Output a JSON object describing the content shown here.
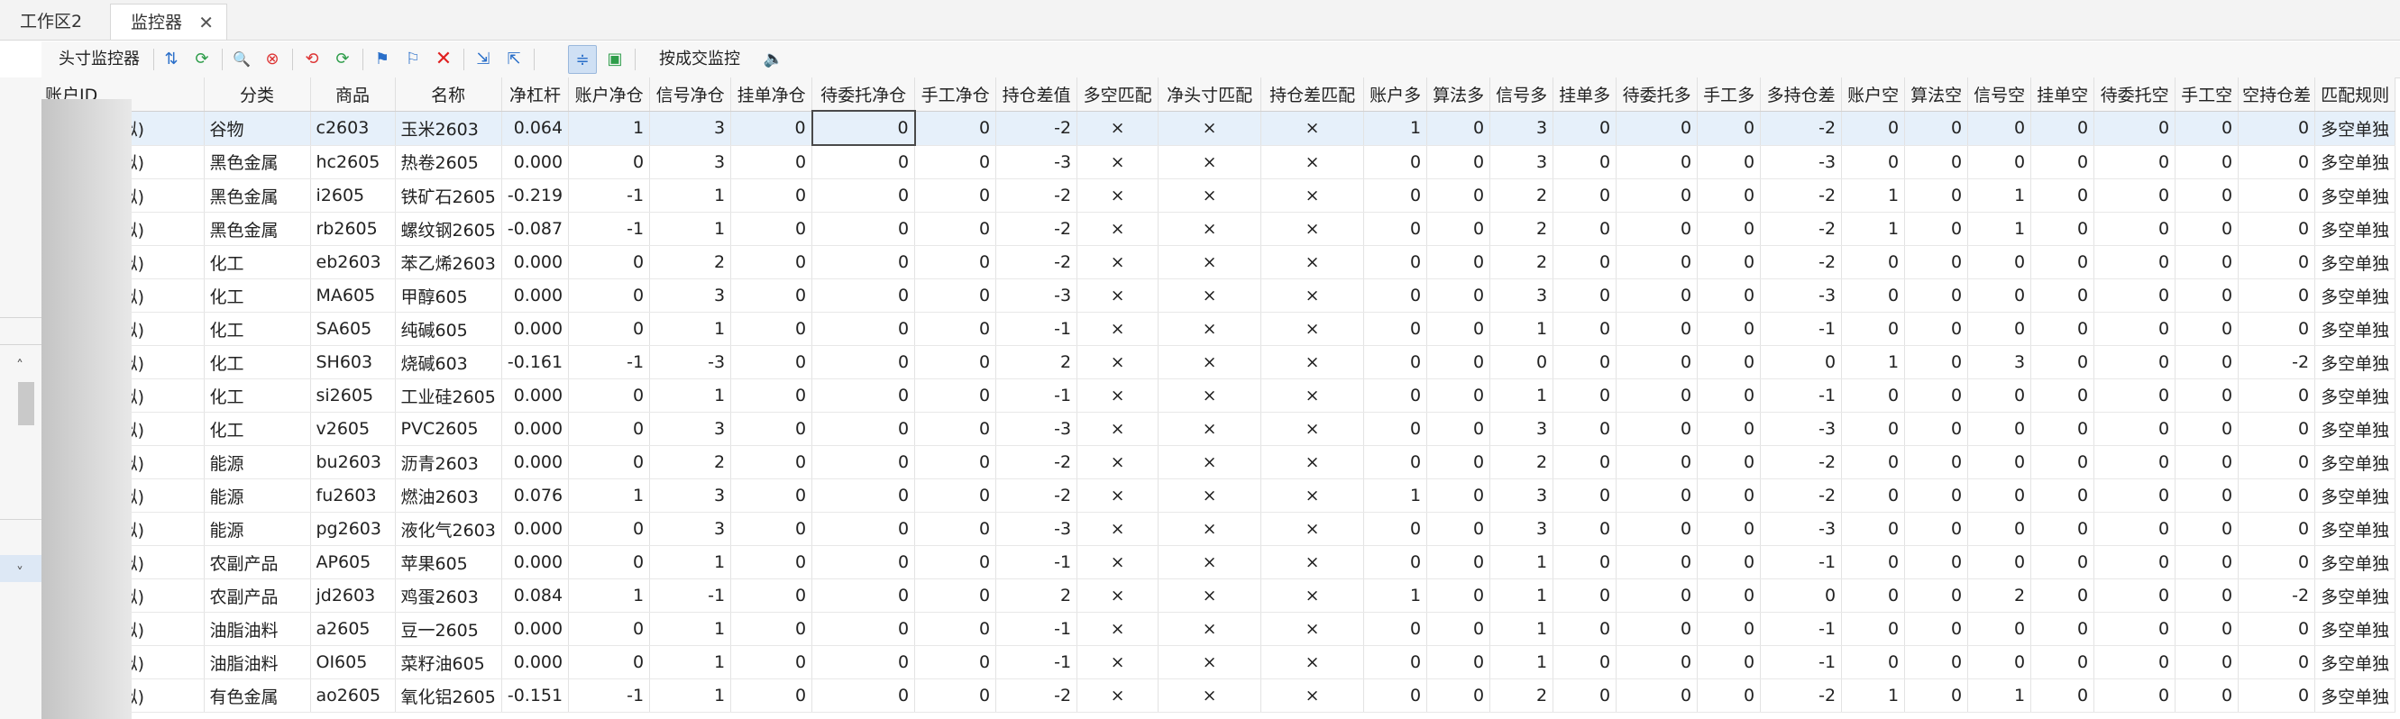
{
  "tabs": [
    {
      "label": "工作区2"
    },
    {
      "label": "监控器",
      "close": "✕"
    }
  ],
  "toolbar": {
    "head_monitor_label": "头寸监控器",
    "trade_monitor_label": "按成交监控"
  },
  "icons": {
    "settings": "⇅",
    "refresh": "⟳",
    "search": "🔍",
    "search_clear": "⊗",
    "sync_a": "⟲",
    "sync_b": "⟳",
    "flag": "⚑",
    "flag_edit": "⚐",
    "delete": "✕",
    "import": "⇲",
    "export": "⇱",
    "filter": "≑",
    "color": "▣",
    "sound": "🔈",
    "scroll_up": "˄",
    "scroll_down": "˅"
  },
  "columns": [
    "账户ID",
    "分类",
    "商品",
    "名称",
    "净杠杆",
    "账户净仓",
    "信号净仓",
    "挂单净仓",
    "待委托净仓",
    "手工净仓",
    "持仓差值",
    "多空匹配",
    "净头寸匹配",
    "持仓差匹配",
    "账户多",
    "算法多",
    "信号多",
    "挂单多",
    "待委托多",
    "手工多",
    "多持仓差",
    "账户空",
    "算法空",
    "信号空",
    "挂单空",
    "待委托空",
    "手工空",
    "空持仓差",
    "匹配规则"
  ],
  "rows": [
    [
      "TB期货模拟)",
      "谷物",
      "c2603",
      "玉米2603",
      "0.064",
      "1",
      "3",
      "0",
      "0",
      "0",
      "-2",
      "×",
      "×",
      "×",
      "1",
      "0",
      "3",
      "0",
      "0",
      "0",
      "-2",
      "0",
      "0",
      "0",
      "0",
      "0",
      "0",
      "0",
      "多空单独"
    ],
    [
      "TB期货模拟)",
      "黑色金属",
      "hc2605",
      "热卷2605",
      "0.000",
      "0",
      "3",
      "0",
      "0",
      "0",
      "-3",
      "×",
      "×",
      "×",
      "0",
      "0",
      "3",
      "0",
      "0",
      "0",
      "-3",
      "0",
      "0",
      "0",
      "0",
      "0",
      "0",
      "0",
      "多空单独"
    ],
    [
      "TB期货模拟)",
      "黑色金属",
      "i2605",
      "铁矿石2605",
      "-0.219",
      "-1",
      "1",
      "0",
      "0",
      "0",
      "-2",
      "×",
      "×",
      "×",
      "0",
      "0",
      "2",
      "0",
      "0",
      "0",
      "-2",
      "1",
      "0",
      "1",
      "0",
      "0",
      "0",
      "0",
      "多空单独"
    ],
    [
      "TB期货模拟)",
      "黑色金属",
      "rb2605",
      "螺纹钢2605",
      "-0.087",
      "-1",
      "1",
      "0",
      "0",
      "0",
      "-2",
      "×",
      "×",
      "×",
      "0",
      "0",
      "2",
      "0",
      "0",
      "0",
      "-2",
      "1",
      "0",
      "1",
      "0",
      "0",
      "0",
      "0",
      "多空单独"
    ],
    [
      "TB期货模拟)",
      "化工",
      "eb2603",
      "苯乙烯2603",
      "0.000",
      "0",
      "2",
      "0",
      "0",
      "0",
      "-2",
      "×",
      "×",
      "×",
      "0",
      "0",
      "2",
      "0",
      "0",
      "0",
      "-2",
      "0",
      "0",
      "0",
      "0",
      "0",
      "0",
      "0",
      "多空单独"
    ],
    [
      "TB期货模拟)",
      "化工",
      "MA605",
      "甲醇605",
      "0.000",
      "0",
      "3",
      "0",
      "0",
      "0",
      "-3",
      "×",
      "×",
      "×",
      "0",
      "0",
      "3",
      "0",
      "0",
      "0",
      "-3",
      "0",
      "0",
      "0",
      "0",
      "0",
      "0",
      "0",
      "多空单独"
    ],
    [
      "TB期货模拟)",
      "化工",
      "SA605",
      "纯碱605",
      "0.000",
      "0",
      "1",
      "0",
      "0",
      "0",
      "-1",
      "×",
      "×",
      "×",
      "0",
      "0",
      "1",
      "0",
      "0",
      "0",
      "-1",
      "0",
      "0",
      "0",
      "0",
      "0",
      "0",
      "0",
      "多空单独"
    ],
    [
      "TB期货模拟)",
      "化工",
      "SH603",
      "烧碱603",
      "-0.161",
      "-1",
      "-3",
      "0",
      "0",
      "0",
      "2",
      "×",
      "×",
      "×",
      "0",
      "0",
      "0",
      "0",
      "0",
      "0",
      "0",
      "1",
      "0",
      "3",
      "0",
      "0",
      "0",
      "-2",
      "多空单独"
    ],
    [
      "TB期货模拟)",
      "化工",
      "si2605",
      "工业硅2605",
      "0.000",
      "0",
      "1",
      "0",
      "0",
      "0",
      "-1",
      "×",
      "×",
      "×",
      "0",
      "0",
      "1",
      "0",
      "0",
      "0",
      "-1",
      "0",
      "0",
      "0",
      "0",
      "0",
      "0",
      "0",
      "多空单独"
    ],
    [
      "TB期货模拟)",
      "化工",
      "v2605",
      "PVC2605",
      "0.000",
      "0",
      "3",
      "0",
      "0",
      "0",
      "-3",
      "×",
      "×",
      "×",
      "0",
      "0",
      "3",
      "0",
      "0",
      "0",
      "-3",
      "0",
      "0",
      "0",
      "0",
      "0",
      "0",
      "0",
      "多空单独"
    ],
    [
      "TB期货模拟)",
      "能源",
      "bu2603",
      "沥青2603",
      "0.000",
      "0",
      "2",
      "0",
      "0",
      "0",
      "-2",
      "×",
      "×",
      "×",
      "0",
      "0",
      "2",
      "0",
      "0",
      "0",
      "-2",
      "0",
      "0",
      "0",
      "0",
      "0",
      "0",
      "0",
      "多空单独"
    ],
    [
      "TB期货模拟)",
      "能源",
      "fu2603",
      "燃油2603",
      "0.076",
      "1",
      "3",
      "0",
      "0",
      "0",
      "-2",
      "×",
      "×",
      "×",
      "1",
      "0",
      "3",
      "0",
      "0",
      "0",
      "-2",
      "0",
      "0",
      "0",
      "0",
      "0",
      "0",
      "0",
      "多空单独"
    ],
    [
      "TB期货模拟)",
      "能源",
      "pg2603",
      "液化气2603",
      "0.000",
      "0",
      "3",
      "0",
      "0",
      "0",
      "-3",
      "×",
      "×",
      "×",
      "0",
      "0",
      "3",
      "0",
      "0",
      "0",
      "-3",
      "0",
      "0",
      "0",
      "0",
      "0",
      "0",
      "0",
      "多空单独"
    ],
    [
      "TB期货模拟)",
      "农副产品",
      "AP605",
      "苹果605",
      "0.000",
      "0",
      "1",
      "0",
      "0",
      "0",
      "-1",
      "×",
      "×",
      "×",
      "0",
      "0",
      "1",
      "0",
      "0",
      "0",
      "-1",
      "0",
      "0",
      "0",
      "0",
      "0",
      "0",
      "0",
      "多空单独"
    ],
    [
      "TB期货模拟)",
      "农副产品",
      "jd2603",
      "鸡蛋2603",
      "0.084",
      "1",
      "-1",
      "0",
      "0",
      "0",
      "2",
      "×",
      "×",
      "×",
      "1",
      "0",
      "1",
      "0",
      "0",
      "0",
      "0",
      "0",
      "0",
      "2",
      "0",
      "0",
      "0",
      "-2",
      "多空单独"
    ],
    [
      "TB期货模拟)",
      "油脂油料",
      "a2605",
      "豆一2605",
      "0.000",
      "0",
      "1",
      "0",
      "0",
      "0",
      "-1",
      "×",
      "×",
      "×",
      "0",
      "0",
      "1",
      "0",
      "0",
      "0",
      "-1",
      "0",
      "0",
      "0",
      "0",
      "0",
      "0",
      "0",
      "多空单独"
    ],
    [
      "TB期货模拟)",
      "油脂油料",
      "OI605",
      "菜籽油605",
      "0.000",
      "0",
      "1",
      "0",
      "0",
      "0",
      "-1",
      "×",
      "×",
      "×",
      "0",
      "0",
      "1",
      "0",
      "0",
      "0",
      "-1",
      "0",
      "0",
      "0",
      "0",
      "0",
      "0",
      "0",
      "多空单独"
    ],
    [
      "TB期货模拟)",
      "有色金属",
      "ao2605",
      "氧化铝2605",
      "-0.151",
      "-1",
      "1",
      "0",
      "0",
      "0",
      "-2",
      "×",
      "×",
      "×",
      "0",
      "0",
      "2",
      "0",
      "0",
      "0",
      "-2",
      "1",
      "0",
      "1",
      "0",
      "0",
      "0",
      "0",
      "多空单独"
    ]
  ]
}
